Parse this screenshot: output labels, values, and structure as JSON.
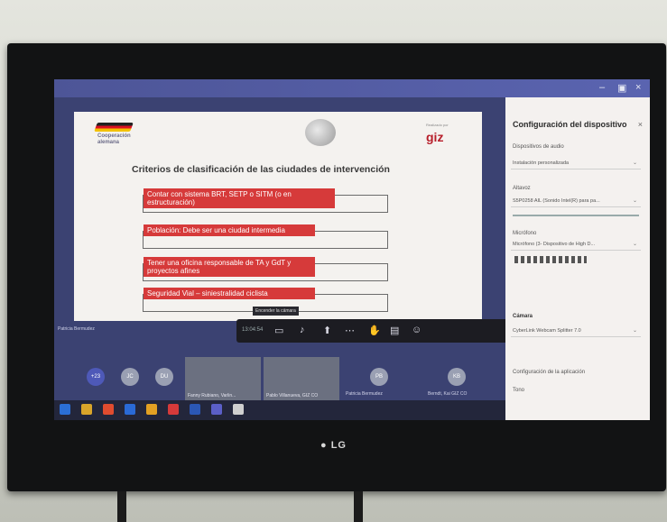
{
  "slide": {
    "logo_text": "Cooperación\nalemana",
    "giz_small": "Realizado por",
    "giz": "giz",
    "title": "Criterios de clasificación de las ciudades de intervención",
    "criteria": [
      "Contar con sistema BRT, SETP o SITM (o en estructuración)",
      "Población: Debe ser una ciudad intermedia",
      "Tener una oficina responsable de TA y GdT y proyectos afines",
      "Seguridad Vial – siniestralidad ciclista"
    ]
  },
  "meeting": {
    "tooltip": "Encender la cámara",
    "timer": "13:04:54",
    "presenter": "Patricia Bermudez",
    "participants": [
      {
        "initials": "+23"
      },
      {
        "initials": "JC"
      },
      {
        "initials": "DU"
      },
      {
        "initials": "PB",
        "label": "Patricia Bermudez"
      },
      {
        "initials": "KB",
        "label": "Berndt, Kai GIZ CO"
      }
    ],
    "videos": [
      {
        "caption": "Fanny Rubiano, Varlin..."
      },
      {
        "caption": "Pablo Villanueva, GIZ CO"
      }
    ]
  },
  "panel": {
    "title": "Configuración del dispositivo",
    "audio_label": "Dispositivos de audio",
    "audio_value": "Instalación personalizada",
    "speaker_label": "Altavoz",
    "speaker_value": "S5P0258 AIL (Sonido Intel(R) para pa...",
    "mic_label": "Micrófono",
    "mic_value": "Micrófono (3- Dispositivo de High D...",
    "camera_label": "Cámara",
    "camera_value": "CyberLink Webcam Splitter 7.0",
    "app_config_label": "Configuración de la aplicación",
    "tone_label": "Tono"
  },
  "tv": {
    "brand": "LG"
  },
  "colors": {
    "accent": "#d63a3a",
    "teams": "#4d5597",
    "hangup": "#c4314b"
  }
}
